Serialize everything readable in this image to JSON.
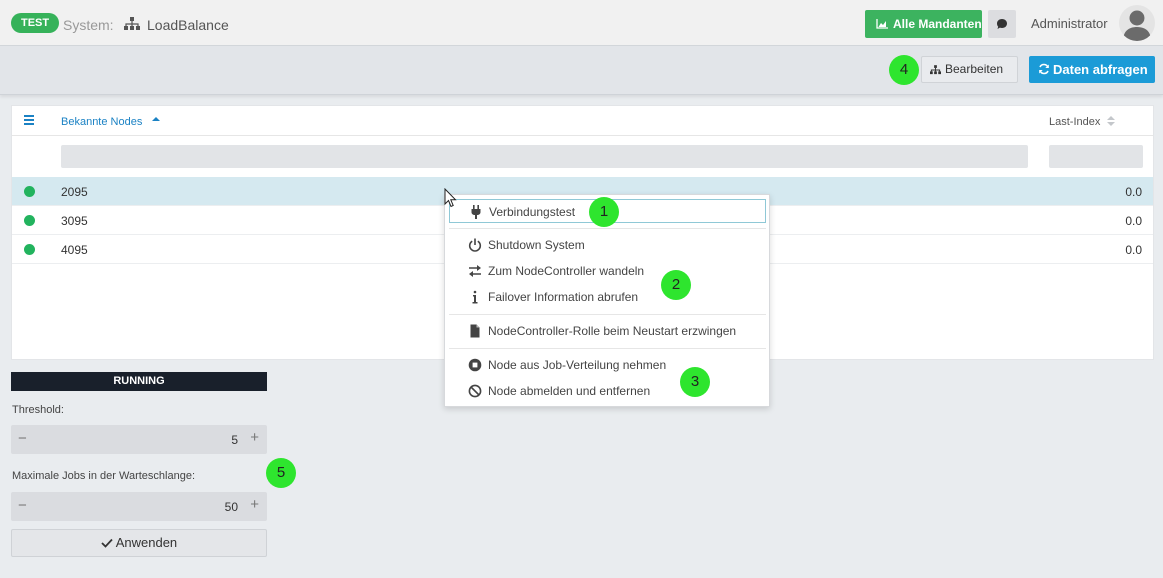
{
  "header": {
    "env_badge": "TEST",
    "system_label": "System:",
    "system_name": "LoadBalance",
    "mandanten_button": "Alle Mandanten",
    "user_name": "Administrator"
  },
  "actions": {
    "edit_label": "Bearbeiten",
    "fetch_label": "Daten abfragen"
  },
  "markers": [
    "1",
    "2",
    "3",
    "4",
    "5"
  ],
  "table": {
    "col_nodes": "Bekannte Nodes",
    "col_index": "Last-Index",
    "filter_nodes_placeholder": "",
    "filter_index_placeholder": "",
    "rows": [
      {
        "node": "2095",
        "index": "0.0",
        "status": "online",
        "selected": true
      },
      {
        "node": "3095",
        "index": "0.0",
        "status": "online",
        "selected": false
      },
      {
        "node": "4095",
        "index": "0.0",
        "status": "online",
        "selected": false
      }
    ]
  },
  "controls": {
    "status": "RUNNING",
    "threshold_label": "Threshold:",
    "threshold_value": "5",
    "max_jobs_label": "Maximale Jobs in der Warteschlange:",
    "max_jobs_value": "50",
    "apply_label": "Anwenden"
  },
  "context_menu": {
    "items": [
      {
        "label": "Verbindungstest",
        "icon": "plug-icon"
      },
      {
        "label": "Shutdown System",
        "icon": "power-icon"
      },
      {
        "label": "Zum NodeController wandeln",
        "icon": "swap-icon"
      },
      {
        "label": "Failover Information abrufen",
        "icon": "info-icon"
      },
      {
        "label": "NodeController-Rolle beim Neustart erzwingen",
        "icon": "file-icon"
      },
      {
        "label": "Node aus Job-Verteilung nehmen",
        "icon": "stop-circle-icon"
      },
      {
        "label": "Node abmelden und entfernen",
        "icon": "ban-icon"
      }
    ]
  },
  "colors": {
    "accent_green": "#3cb35f",
    "accent_blue": "#1b9bd7",
    "status_dark": "#19202b",
    "marker_green": "#2ee52e"
  }
}
